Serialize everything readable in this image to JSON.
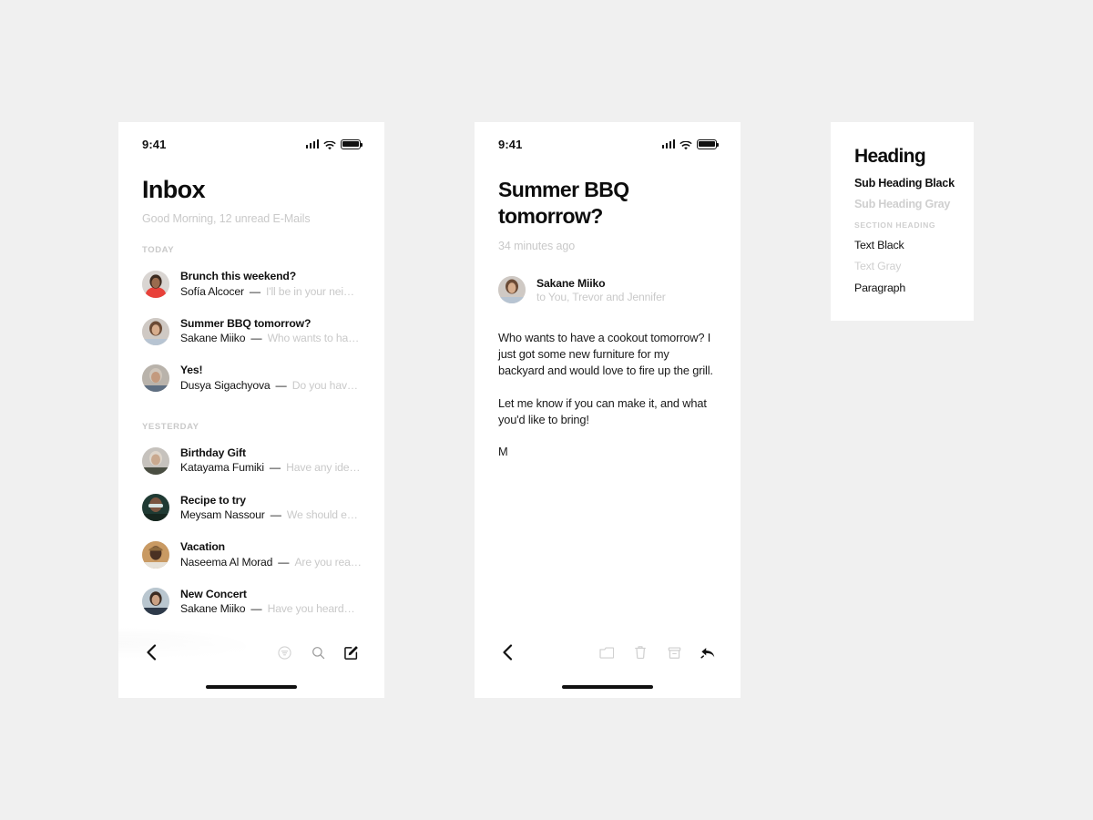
{
  "canvas": {
    "background": "#f0f0f0"
  },
  "palette": {
    "black": "#111111",
    "gray": "#c9c9c9",
    "panel_gray": "#cfcfcf",
    "white": "#ffffff"
  },
  "status_bar": {
    "time": "9:41",
    "icons": [
      "signal-icon",
      "wifi-icon",
      "battery-icon"
    ]
  },
  "inbox_screen": {
    "title": "Inbox",
    "subtitle": "Good Morning, 12 unread E-Mails",
    "sections": [
      {
        "label": "TODAY",
        "items": [
          {
            "subject": "Brunch this weekend?",
            "sender": "Sofía Alcocer",
            "dash": "—",
            "preview": "I'll be in your nei…",
            "avatar": "avatar-sofia"
          },
          {
            "subject": "Summer BBQ tomorrow?",
            "sender": "Sakane Miiko",
            "dash": "—",
            "preview": "Who wants to ha…",
            "avatar": "avatar-sakane"
          },
          {
            "subject": "Yes!",
            "sender": "Dusya Sigachyova",
            "dash": "—",
            "preview": "Do you hav…",
            "avatar": "avatar-dusya"
          }
        ]
      },
      {
        "label": "YESTERDAY",
        "items": [
          {
            "subject": "Birthday Gift",
            "sender": "Katayama Fumiki",
            "dash": "—",
            "preview": "Have any ide…",
            "avatar": "avatar-katayama"
          },
          {
            "subject": "Recipe to try",
            "sender": "Meysam Nassour",
            "dash": "—",
            "preview": "We should e…",
            "avatar": "avatar-meysam"
          },
          {
            "subject": "Vacation",
            "sender": "Naseema Al Morad",
            "dash": "—",
            "preview": "Are you rea…",
            "avatar": "avatar-naseema"
          },
          {
            "subject": "New Concert",
            "sender": "Sakane Miiko",
            "dash": "—",
            "preview": "Have you heard…",
            "avatar": "avatar-sakane2"
          }
        ]
      }
    ],
    "toolbar": {
      "back": "back-chevron-icon",
      "actions": [
        "filter-icon",
        "search-icon",
        "compose-icon"
      ]
    }
  },
  "detail_screen": {
    "title": "Summer BBQ tomorrow?",
    "timestamp": "34 minutes ago",
    "sender_name": "Sakane Miiko",
    "recipients": "to You, Trevor and Jennifer",
    "body_paragraphs": [
      "Who wants to have a cookout tomorrow? I just got some new furniture for my backyard and would love to fire up the grill.",
      "Let me know if you can make it, and what you'd like to bring!",
      "M"
    ],
    "toolbar": {
      "back": "back-chevron-icon",
      "actions": [
        "folder-icon",
        "trash-icon",
        "archive-icon",
        "reply-icon"
      ]
    }
  },
  "type_panel": {
    "heading": "Heading",
    "sub_heading_black": "Sub Heading Black",
    "sub_heading_gray": "Sub Heading Gray",
    "section_heading": "SECTION HEADING",
    "text_black": "Text Black",
    "text_gray": "Text Gray",
    "paragraph": "Paragraph"
  }
}
